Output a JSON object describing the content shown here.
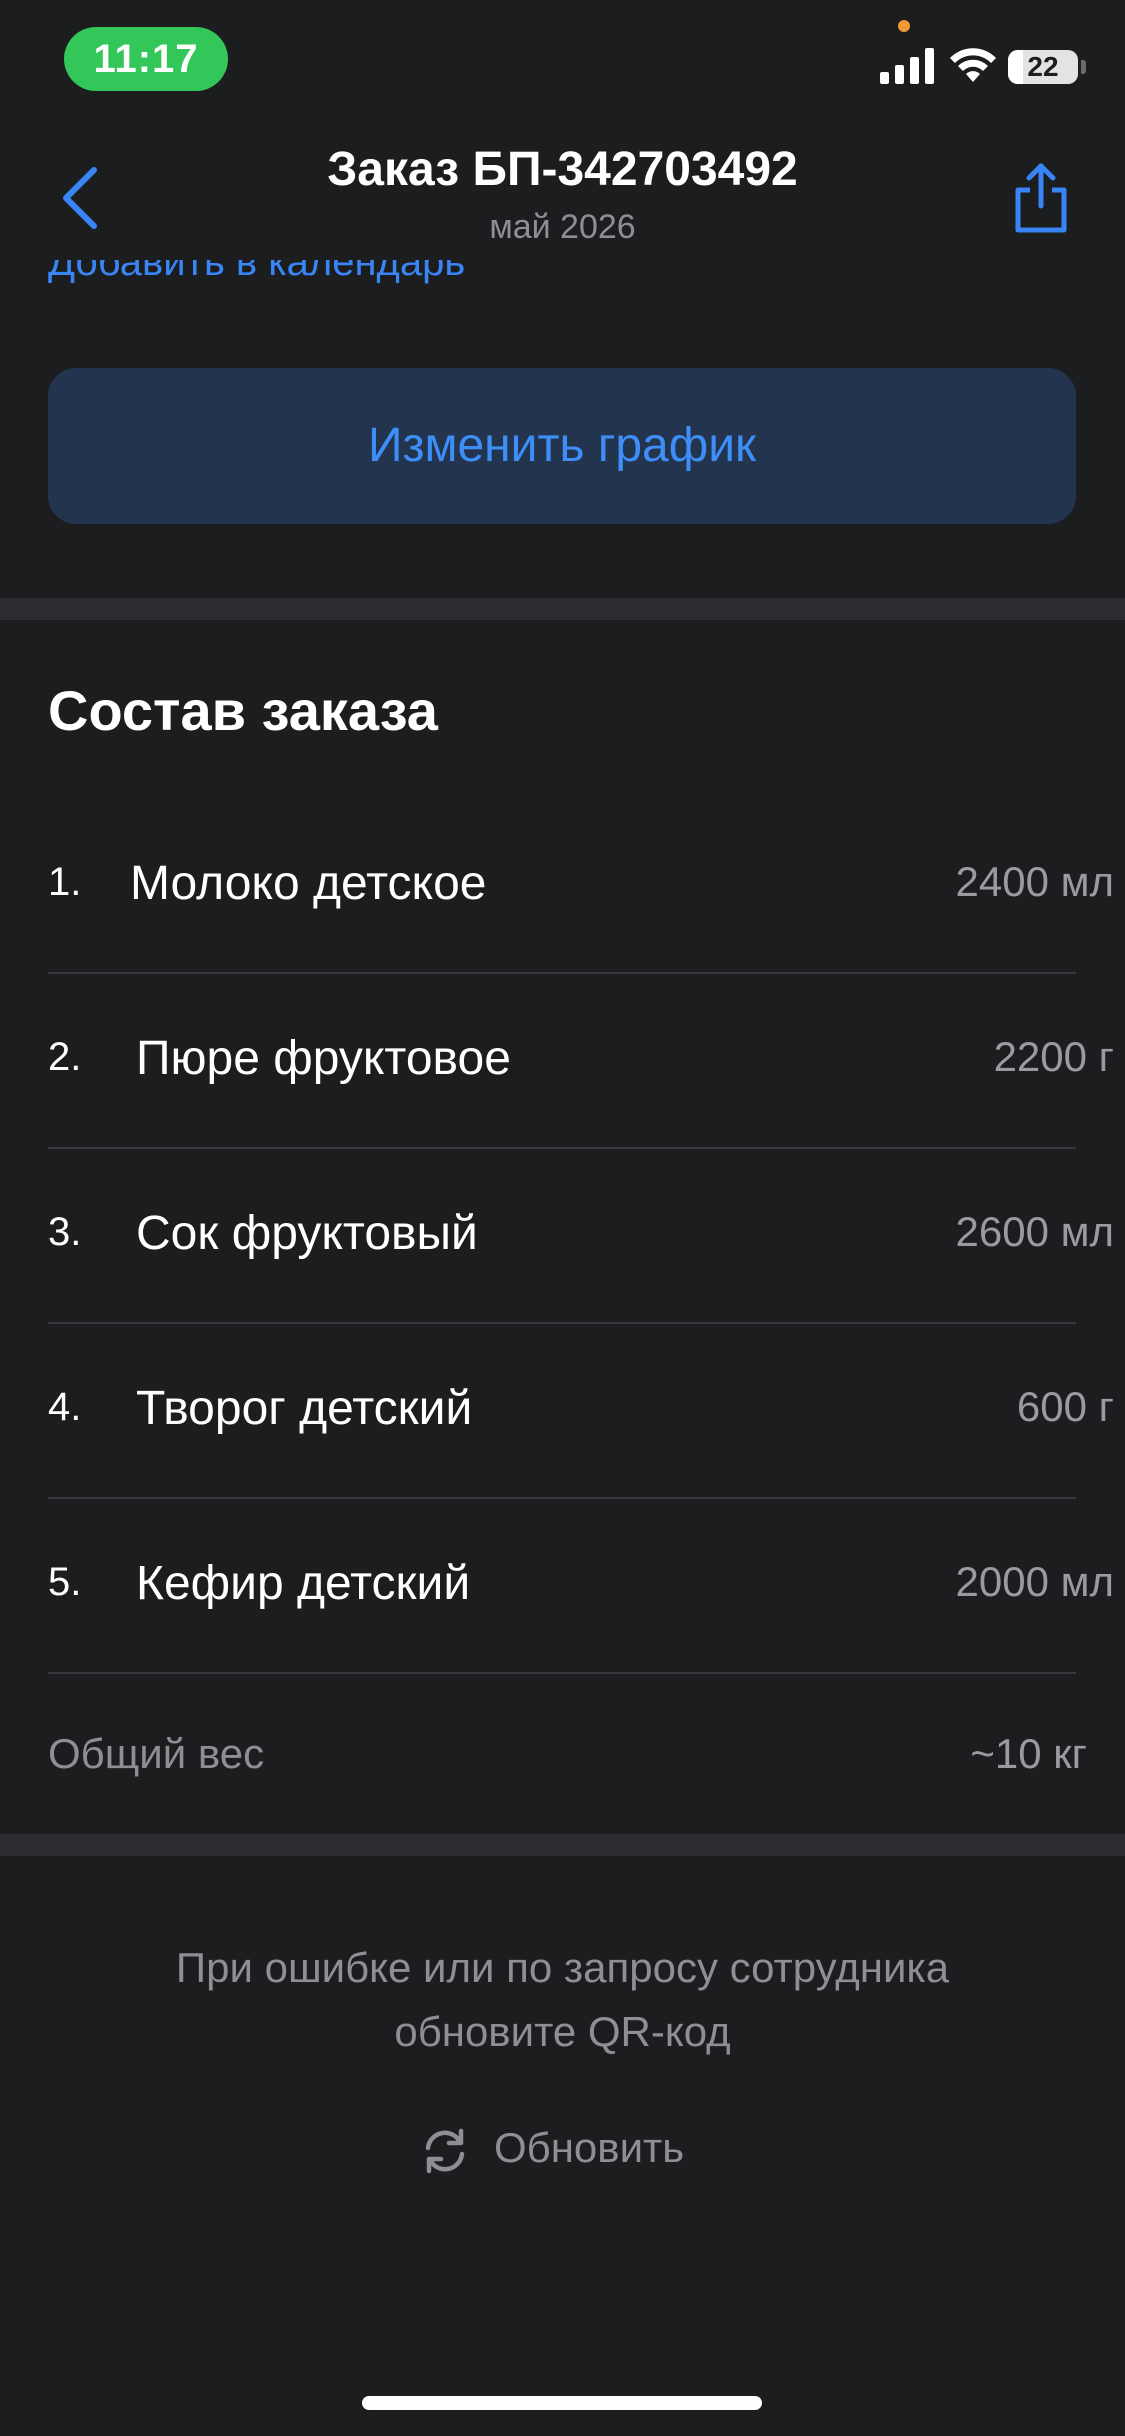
{
  "status_bar": {
    "time": "11:17",
    "battery": "22",
    "battery_level": 0.22
  },
  "header": {
    "title": "Заказ БП-342703492",
    "subtitle": "май 2026",
    "back_icon": "chevron-left-icon",
    "share_icon": "share-icon"
  },
  "top": {
    "calendar_link": "Добавить в календарь",
    "change_schedule": "Изменить график"
  },
  "order": {
    "title": "Состав заказа",
    "items": [
      {
        "num": "1.",
        "name": "Молоко детское",
        "qty": "2400 мл"
      },
      {
        "num": "2.",
        "name": "Пюре фруктовое",
        "qty": "2200 г"
      },
      {
        "num": "3.",
        "name": "Сок фруктовый",
        "qty": "2600 мл"
      },
      {
        "num": "4.",
        "name": "Творог детский",
        "qty": "600 г"
      },
      {
        "num": "5.",
        "name": "Кефир детский",
        "qty": "2000 мл"
      }
    ],
    "total_label": "Общий вес",
    "total_value": "~10 кг"
  },
  "footer": {
    "hint": "При ошибке или по запросу сотрудника обновите QR-код",
    "refresh_label": "Обновить",
    "refresh_icon": "refresh-icon"
  },
  "colors": {
    "background": "#1c1d1f",
    "accent": "#3a85f5",
    "button_bg": "#23344e",
    "secondary_text": "#8e8e93",
    "status_pill": "#33c659"
  }
}
